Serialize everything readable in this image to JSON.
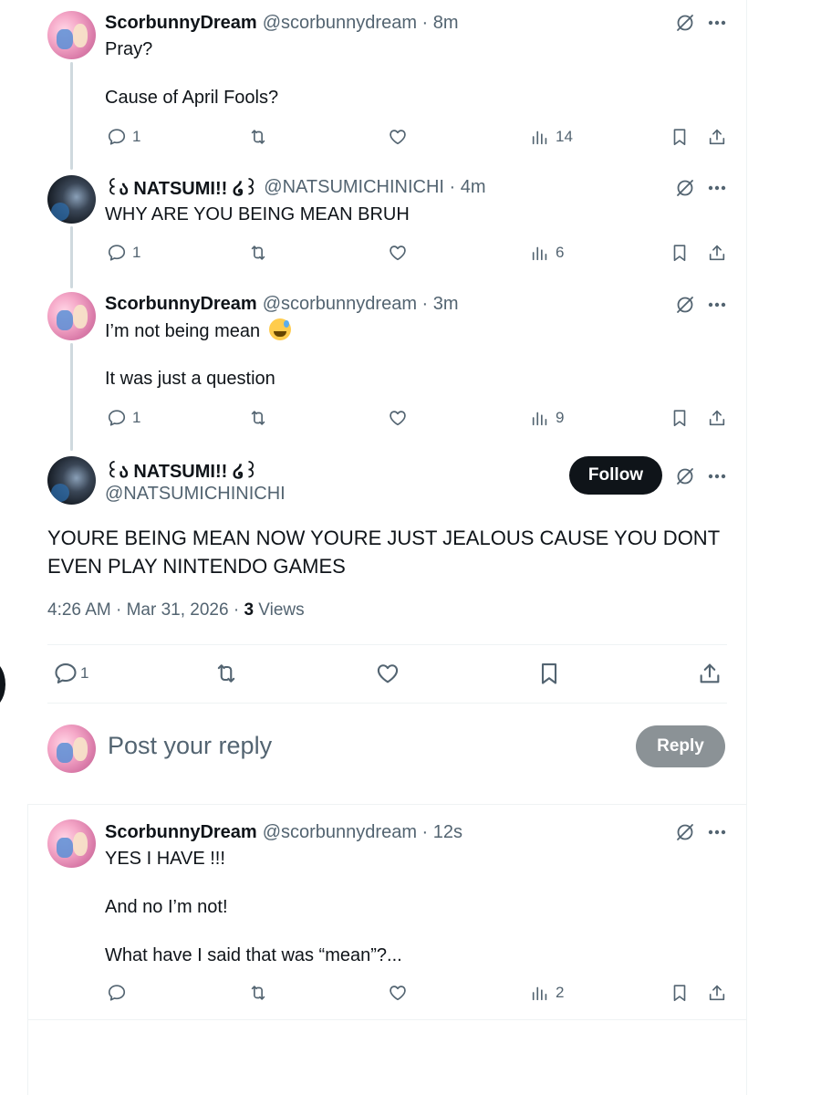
{
  "replies_above": [
    {
      "name": "ScorbunnyDream",
      "handle": "@scorbunnydream · 8m",
      "lines": [
        "Pray?",
        "Cause of April Fools?"
      ],
      "reply_count": "1",
      "views": "14"
    },
    {
      "name": "꒰ა NATSUMI!! ໒꒱",
      "handle": "@NATSUMICHINICHI · 4m",
      "lines": [
        "WHY ARE YOU BEING MEAN BRUH"
      ],
      "reply_count": "1",
      "views": "6"
    },
    {
      "name": "ScorbunnyDream",
      "handle": "@scorbunnydream · 3m",
      "lines": [
        "I’m not being mean",
        "It was just a question"
      ],
      "reply_count": "1",
      "views": "9"
    }
  ],
  "main_tweet": {
    "name": "꒰ა NATSUMI!! ໒꒱",
    "handle": "@NATSUMICHINICHI",
    "follow_label": "Follow",
    "text": "YOURE BEING MEAN NOW YOURE JUST JEALOUS CAUSE YOU DONT EVEN PLAY NINTENDO GAMES",
    "timestamp": "4:26 AM · Mar 31, 2026 · ",
    "views_count": "3",
    "views_label": " Views",
    "reply_count": "1"
  },
  "composer": {
    "placeholder": "Post your reply",
    "reply_label": "Reply"
  },
  "reply_below": {
    "name": "ScorbunnyDream",
    "handle": "@scorbunnydream · 12s",
    "lines": [
      "YES I HAVE !!!",
      "And no I’m not!",
      "What have I said that was “mean”?..."
    ],
    "views": "2"
  },
  "icons": {
    "reply": "reply-icon",
    "retweet": "retweet-icon",
    "like": "heart-icon",
    "views": "views-icon",
    "bookmark": "bookmark-icon",
    "share": "share-icon",
    "grok": "grok-icon",
    "more": "more-icon"
  },
  "colors": {
    "text": "#0f1419",
    "secondary": "#536471",
    "follow_bg": "#0f1419",
    "reply_btn_bg": "#8b9296",
    "divider": "#eff3f4"
  }
}
